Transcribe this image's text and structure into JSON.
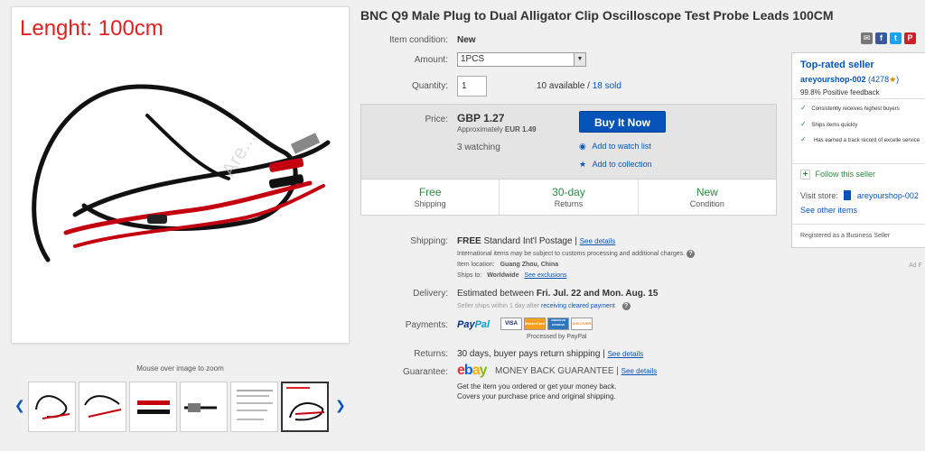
{
  "image": {
    "overlay_text": "Lenght: 100cm",
    "zoom_hint": "Mouse over image to zoom",
    "watermark": "Are..."
  },
  "title": "BNC Q9 Male Plug to Dual Alligator Clip Oscilloscope Test Probe Leads 100CM",
  "share": [
    "mail-icon",
    "facebook-icon",
    "twitter-icon",
    "pinterest-icon"
  ],
  "condition": {
    "label": "Item condition:",
    "value": "New"
  },
  "amount": {
    "label": "Amount:",
    "value": "1PCS"
  },
  "quantity": {
    "label": "Quantity:",
    "value": "1",
    "available": "10 available",
    "sep": " / ",
    "sold": "18 sold"
  },
  "price": {
    "label": "Price:",
    "value": "GBP 1.27",
    "approx_prefix": "Approximately ",
    "approx_value": "EUR 1.49",
    "watching": "3 watching",
    "buy_now": "Buy It Now",
    "watch_list": "Add to watch list",
    "collection": "Add to collection"
  },
  "features": [
    {
      "big": "Free",
      "small": "Shipping"
    },
    {
      "big": "30-day",
      "small": "Returns"
    },
    {
      "big": "New",
      "small": "Condition"
    }
  ],
  "shipping": {
    "label": "Shipping:",
    "free": "FREE",
    "method": "Standard Int'l Postage",
    "see": "See details",
    "intl_note": "International items may be subject to customs processing and additional charges.",
    "location_label": "Item location:",
    "location": "Guang Zhou, China",
    "ships_label": "Ships to:",
    "ships": "Worldwide",
    "exclusions": "See exclusions"
  },
  "delivery": {
    "label": "Delivery:",
    "prefix": "Estimated between",
    "dates": "Fri. Jul. 22 and Mon. Aug. 15",
    "note": "Seller ships within 1 day after",
    "note_link": "receiving cleared payment",
    "note_end": "."
  },
  "payments": {
    "label": "Payments:",
    "paypal_a": "Pay",
    "paypal_b": "Pal",
    "cards": [
      "VISA",
      "MasterCard",
      "AMERICAN EXPRESS",
      "DISCOVER"
    ],
    "processed": "Processed by PayPal"
  },
  "returns": {
    "label": "Returns:",
    "value": "30 days, buyer pays return shipping",
    "see": "See details"
  },
  "guarantee": {
    "label": "Guarantee:",
    "ebay": [
      "e",
      "b",
      "a",
      "y"
    ],
    "text": "MONEY BACK GUARANTEE",
    "see": "See details",
    "line1": "Get the item you ordered or get your money back.",
    "line2": "Covers your purchase price and original shipping."
  },
  "seller": {
    "heading": "Top-rated seller",
    "name": "areyourshop-002",
    "score_open": "(",
    "score": "4278",
    "score_close": ")",
    "feedback": "99.8% Positive feedback",
    "badges": [
      "Consistently receives highest buyers",
      "Ships items quickly",
      "Has earned a track record of excelle service"
    ],
    "follow": "Follow this seller",
    "visit_label": "Visit store:",
    "store": "areyourshop-002",
    "other": "See other items",
    "registered": "Registered as a Business Seller"
  },
  "ad_label": "Ad F"
}
